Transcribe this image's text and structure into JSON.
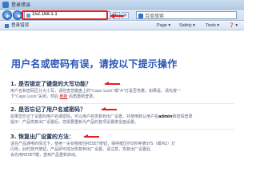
{
  "window": {
    "title": "登录错误"
  },
  "nav": {
    "address": "152.168.1.1",
    "search_placeholder": "百度搜索",
    "refresh_symbol": "↻",
    "stop_symbol": "✕"
  },
  "tab": {
    "label": "登录错误"
  },
  "commands": {
    "page": "Page ▾",
    "safety": "Safety ▾",
    "tools": "Tools ▾",
    "help": "❓ ▾"
  },
  "content": {
    "heading": "用户名或密码有误，请按以下提示操作",
    "sections": [
      {
        "title": "1. 是否锁定了键盘的大写功能？",
        "lines": [
          "用户名和密码区分大小写，请检查您键盘上的\"Caps Lock\"或\"A\"灯是否亮着，如果是，请先按一",
          "下\"Caps Lock\"关闭，然后",
          "后再重新登录。"
        ],
        "link": "刷新"
      },
      {
        "title": "2. 是否忘记了用户名或密码？",
        "lines": [
          "如果您忘记了设置的用户名或密码，可以用户名恢复到出厂设置，并使用默认用户名",
          "admin",
          "和密码登录",
          "提示：产品恢复出厂设置后，您需要重新为产品的各项设置做全面设置。"
        ]
      },
      {
        "title": "3. 恢复出厂设置的方法：",
        "lines": [
          "请在产品通电的情况下，使用一尖状物按住RESET按钮，保持按压约5秒钟使SYS（或M2）灯",
          "闪烁，此时放开按钮，产品即可成功恢复到出厂设置。请注意，恢复出厂设置后",
          "会先用RESET键，直到产品重新启动。"
        ]
      }
    ]
  },
  "colors": {
    "accent": "#2a56b8",
    "annotation_red": "#e41e1e"
  }
}
